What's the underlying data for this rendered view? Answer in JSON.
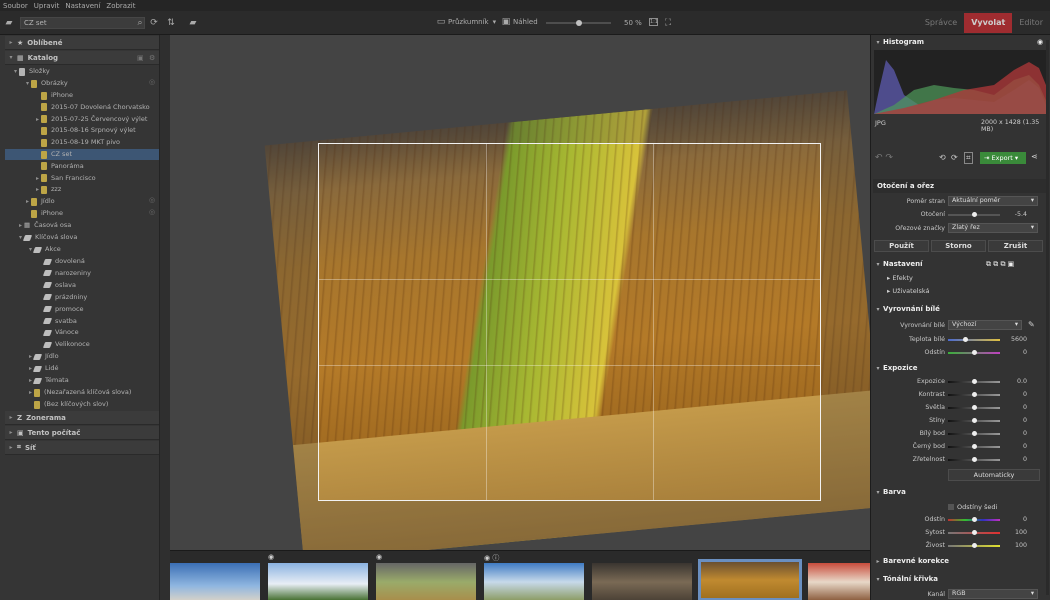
{
  "menu": [
    "Soubor",
    "Upravit",
    "Nastavení",
    "Zobrazit"
  ],
  "toolbar": {
    "search_value": "CZ set",
    "view_prostor": "Průzkumník",
    "view_nahled": "Náhled",
    "zoom": "50 %",
    "zoom_level": 0.5,
    "modes": [
      "Správce",
      "Vyvolat",
      "Editor"
    ]
  },
  "left": {
    "oblibene": "Oblíbené",
    "katalog": "Katalog",
    "slozky": "Složky",
    "obrazky": "Obrázky",
    "folders": [
      "iPhone",
      "2015-07 Dovolená Chorvatsko",
      "2015-07-25 Červencový výlet",
      "2015-08-16 Srpnový výlet",
      "2015-08-19 MKT pivo",
      "CZ set",
      "Panoráma",
      "San Francisco",
      "zzz"
    ],
    "jidlo": "Jídlo",
    "iphone2": "iPhone",
    "casova_osa": "Časová osa",
    "klicova_slova": "Klíčová slova",
    "akce": "Akce",
    "akce_items": [
      "dovolená",
      "narozeniny",
      "oslava",
      "prázdniny",
      "promoce",
      "svatba",
      "Vánoce",
      "Velikonoce"
    ],
    "kw_more": [
      "Jídlo",
      "Lidé",
      "Témata"
    ],
    "nezarazena": "(Nezařazená klíčová slova)",
    "bez": "(Bez klíčových slov)",
    "zonerama": "Zonerama",
    "pocitac": "Tento počítač",
    "sit": "Síť"
  },
  "right": {
    "histogram": "Histogram",
    "format": "JPG",
    "dims": "2000 x 1428 (1.35 MB)",
    "export": "Export",
    "otoceni_title": "Otočení a ořez",
    "pomer_label": "Poměr stran",
    "pomer_value": "Aktuální poměr",
    "otoceni_label": "Otočení",
    "otoceni_value": "-5.4",
    "orez_label": "Ořezové značky",
    "orez_value": "Zlatý řez",
    "pouzit": "Použít",
    "storno": "Storno",
    "zrusit": "Zrušit",
    "nastaveni": "Nastavení",
    "efekty": "Efekty",
    "uzivatelska": "Uživatelská",
    "vyrovnani": "Vyrovnání bílé",
    "vyrovnani_label": "Vyrovnání bílé",
    "vyrovnani_value": "Výchozí",
    "teplota_label": "Teplota bílé",
    "teplota_value": "5600",
    "odstin_label": "Odstín",
    "odstin_value": "0",
    "expozice_title": "Expozice",
    "expozice_rows": [
      {
        "label": "Expozice",
        "value": "0.0"
      },
      {
        "label": "Kontrast",
        "value": "0"
      },
      {
        "label": "Světla",
        "value": "0"
      },
      {
        "label": "Stíny",
        "value": "0"
      },
      {
        "label": "Bílý bod",
        "value": "0"
      },
      {
        "label": "Černý bod",
        "value": "0"
      },
      {
        "label": "Zřetelnost",
        "value": "0"
      }
    ],
    "automaticky": "Automaticky",
    "barva": "Barva",
    "odstiny_sedi": "Odstíny šedi",
    "barva_rows": [
      {
        "label": "Odstín",
        "value": "0"
      },
      {
        "label": "Sytost",
        "value": "100"
      },
      {
        "label": "Živost",
        "value": "100"
      }
    ],
    "barevne": "Barevné korekce",
    "tonalni": "Tónální křivka",
    "kanal_label": "Kanál",
    "kanal_value": "RGB"
  },
  "colors": {
    "accent": "#c1272d",
    "selection": "#3e5f87",
    "export_green": "#3a8a3a"
  }
}
